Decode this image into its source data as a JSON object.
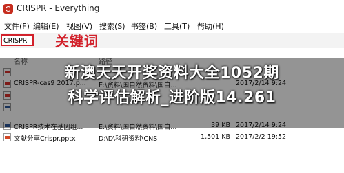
{
  "window": {
    "title": "CRISPR - Everything"
  },
  "menu": [
    {
      "label": "文件(",
      "key": "F",
      "end": ")"
    },
    {
      "label": "编辑(",
      "key": "E",
      "end": ")"
    },
    {
      "label": "视图(",
      "key": "V",
      "end": ")"
    },
    {
      "label": "搜索(",
      "key": "S",
      "end": ")"
    },
    {
      "label": "书签(",
      "key": "B",
      "end": ")"
    },
    {
      "label": "工具(",
      "key": "T",
      "end": ")"
    },
    {
      "label": "帮助(",
      "key": "H",
      "end": ")"
    }
  ],
  "search": {
    "value": "CRISPR",
    "annotation": "关键词"
  },
  "columns": {
    "name": "名称",
    "path": "路径"
  },
  "files": [
    {
      "name": "",
      "path": "",
      "size": "",
      "date": "",
      "icon": "pdf"
    },
    {
      "name": "CRISPR-cas9 2017.p...",
      "path": "E:\\资料\\国自然资料\\国自...",
      "size": "",
      "date": "2017/2/14 9:24",
      "icon": "pdf"
    },
    {
      "name": "",
      "path": "",
      "size": "",
      "date": "",
      "icon": "pdf"
    },
    {
      "name": "",
      "path": "",
      "size": "",
      "date": "",
      "icon": "doc"
    },
    {
      "name": "CRISPR技术在基因组...",
      "path": "E:\\资料\\国自然资料\\国自...",
      "size": "39 KB",
      "date": "2017/2/14 9:24",
      "icon": "doc"
    },
    {
      "name": "文献分享Crispr.pptx",
      "path": "D:\\D\\科研资料\\CNS",
      "size": "1,501 KB",
      "date": "2017/2/2 19:52",
      "icon": "pptx"
    }
  ],
  "overlay": {
    "line1": "新澳天天开奖资料大全1052期",
    "line2": "科学评估解析_进阶版14.261"
  },
  "colors": {
    "accent": "#d2202a"
  }
}
